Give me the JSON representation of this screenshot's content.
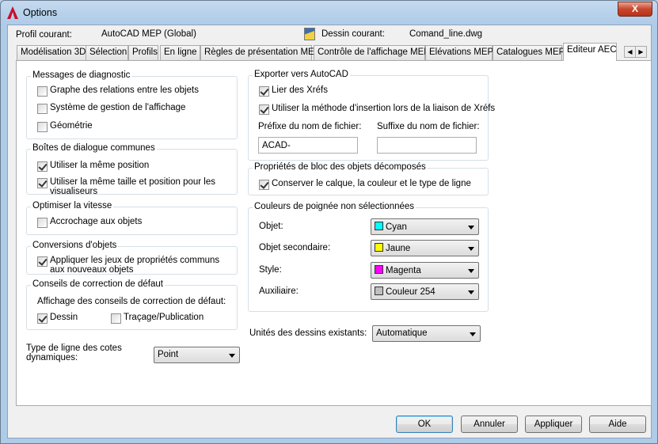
{
  "window": {
    "title": "Options",
    "close": "X"
  },
  "profile": {
    "label": "Profil courant:",
    "value": "AutoCAD MEP (Global)",
    "drawing_label": "Dessin courant:",
    "drawing_value": "Comand_line.dwg"
  },
  "tabs": [
    "Modélisation 3D",
    "Sélection",
    "Profils",
    "En ligne",
    "Règles de présentation MEP",
    "Contrôle de l'affichage MEP",
    "Elévations MEP",
    "Catalogues MEP",
    "Editeur AEC"
  ],
  "active_tab": "Editeur AEC",
  "diag": {
    "title": "Messages de diagnostic",
    "items": [
      {
        "label": "Graphe des relations entre les objets",
        "checked": false
      },
      {
        "label": "Système de gestion de l'affichage",
        "checked": false
      },
      {
        "label": "Géométrie",
        "checked": false
      }
    ]
  },
  "dialogs": {
    "title": "Boîtes de dialogue communes",
    "items": [
      {
        "label": "Utiliser la même position",
        "checked": true
      },
      {
        "label": "Utiliser la même taille et position pour les visualiseurs",
        "checked": true
      }
    ]
  },
  "speed": {
    "title": "Optimiser la vitesse",
    "items": [
      {
        "label": "Accrochage aux objets",
        "checked": false
      }
    ]
  },
  "conv": {
    "title": "Conversions d'objets",
    "items": [
      {
        "label": "Appliquer les jeux de propriétés communs aux nouveaux objets",
        "checked": true
      }
    ]
  },
  "hints": {
    "title": "Conseils de correction de défaut",
    "sublabel": "Affichage des conseils de correction de défaut:",
    "items": [
      {
        "label": "Dessin",
        "checked": true
      },
      {
        "label": "Traçage/Publication",
        "checked": false
      }
    ]
  },
  "linetype": {
    "label": "Type de ligne des cotes dynamiques:",
    "value": "Point"
  },
  "export": {
    "title": "Exporter vers AutoCAD",
    "items": [
      {
        "label": "Lier des Xréfs",
        "checked": true
      },
      {
        "label": "Utiliser la méthode d'insertion lors de la liaison de Xréfs",
        "checked": true
      }
    ],
    "prefix_label": "Préfixe du nom de fichier:",
    "prefix_value": "ACAD-",
    "suffix_label": "Suffixe du nom de fichier:",
    "suffix_value": ""
  },
  "block": {
    "title": "Propriétés de bloc des objets décomposés",
    "items": [
      {
        "label": "Conserver le calque, la couleur et le type de ligne",
        "checked": true
      }
    ]
  },
  "grips": {
    "title": "Couleurs de poignée non sélectionnées",
    "rows": [
      {
        "label": "Objet:",
        "value": "Cyan",
        "color": "#00ffff"
      },
      {
        "label": "Objet secondaire:",
        "value": "Jaune",
        "color": "#ffff00"
      },
      {
        "label": "Style:",
        "value": "Magenta",
        "color": "#ff00ff"
      },
      {
        "label": "Auxiliaire:",
        "value": "Couleur 254",
        "color": "#c0c0c0"
      }
    ]
  },
  "units": {
    "label": "Unités des dessins existants:",
    "value": "Automatique"
  },
  "buttons": {
    "ok": "OK",
    "cancel": "Annuler",
    "apply": "Appliquer",
    "help": "Aide"
  }
}
